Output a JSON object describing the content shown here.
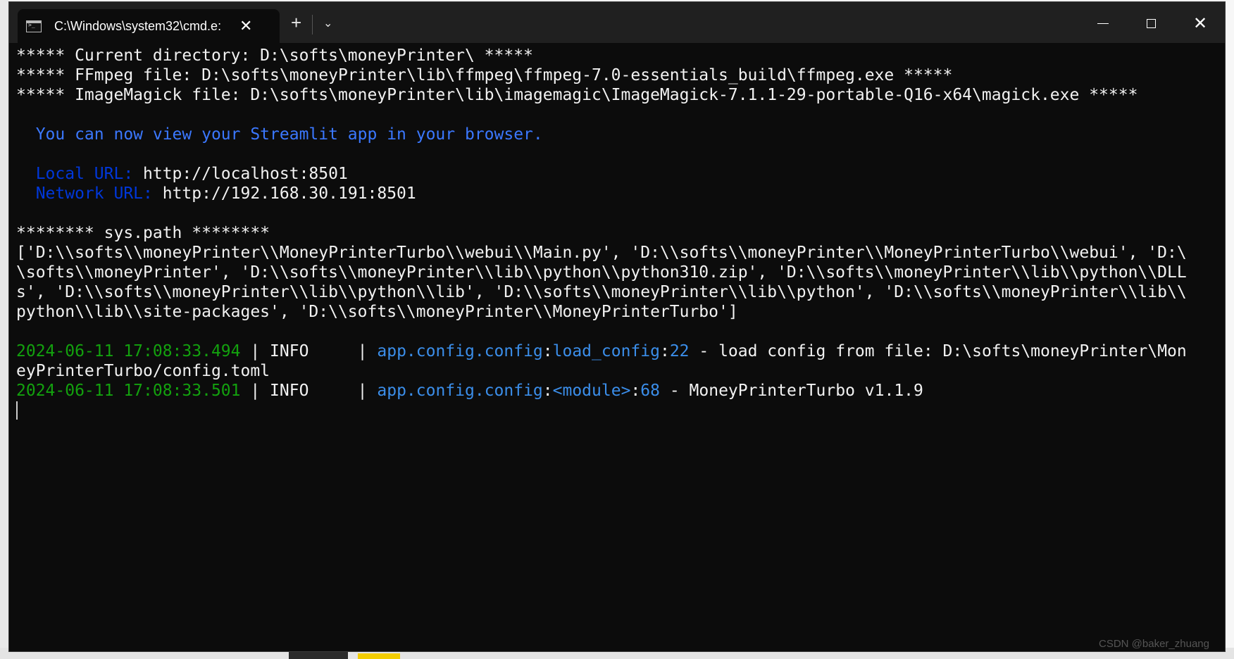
{
  "window": {
    "tab_title": "C:\\Windows\\system32\\cmd.e:",
    "close_tab_glyph": "✕",
    "new_tab_glyph": "+",
    "dropdown_glyph": "⌄",
    "close_window_glyph": "✕"
  },
  "console": {
    "lines": [
      [
        {
          "t": "***** Current directory: D:\\softs\\moneyPrinter\\ *****",
          "c": "white"
        }
      ],
      [
        {
          "t": "***** FFmpeg file: D:\\softs\\moneyPrinter\\lib\\ffmpeg\\ffmpeg-7.0-essentials_build\\ffmpeg.exe *****",
          "c": "white"
        }
      ],
      [
        {
          "t": "***** ImageMagick file: D:\\softs\\moneyPrinter\\lib\\imagemagic\\ImageMagick-7.1.1-29-portable-Q16-x64\\magick.exe *****",
          "c": "white"
        }
      ],
      [],
      [
        {
          "t": "  You can now view your Streamlit app in your browser.",
          "c": "blue"
        }
      ],
      [],
      [
        {
          "t": "  Local URL: ",
          "c": "dblue"
        },
        {
          "t": "http://localhost:8501",
          "c": "white"
        }
      ],
      [
        {
          "t": "  Network URL: ",
          "c": "dblue"
        },
        {
          "t": "http://192.168.30.191:8501",
          "c": "white"
        }
      ],
      [],
      [
        {
          "t": "******** sys.path ********",
          "c": "white"
        }
      ],
      [
        {
          "t": "['D:\\\\softs\\\\moneyPrinter\\\\MoneyPrinterTurbo\\\\webui\\\\Main.py', 'D:\\\\softs\\\\moneyPrinter\\\\MoneyPrinterTurbo\\\\webui', 'D:\\",
          "c": "white"
        }
      ],
      [
        {
          "t": "\\softs\\\\moneyPrinter', 'D:\\\\softs\\\\moneyPrinter\\\\lib\\\\python\\\\python310.zip', 'D:\\\\softs\\\\moneyPrinter\\\\lib\\\\python\\\\DLL",
          "c": "white"
        }
      ],
      [
        {
          "t": "s', 'D:\\\\softs\\\\moneyPrinter\\\\lib\\\\python\\\\lib', 'D:\\\\softs\\\\moneyPrinter\\\\lib\\\\python', 'D:\\\\softs\\\\moneyPrinter\\\\lib\\\\",
          "c": "white"
        }
      ],
      [
        {
          "t": "python\\\\lib\\\\site-packages', 'D:\\\\softs\\\\moneyPrinter\\\\MoneyPrinterTurbo']",
          "c": "white"
        }
      ],
      [],
      [
        {
          "t": "2024-06-11 17:08:33.494",
          "c": "green"
        },
        {
          "t": " | INFO     | ",
          "c": "white"
        },
        {
          "t": "app.config.config",
          "c": "cyan"
        },
        {
          "t": ":",
          "c": "white"
        },
        {
          "t": "load_config",
          "c": "cyan"
        },
        {
          "t": ":",
          "c": "white"
        },
        {
          "t": "22",
          "c": "cyan"
        },
        {
          "t": " - load config from file: D:\\softs\\moneyPrinter\\Mon",
          "c": "white"
        }
      ],
      [
        {
          "t": "eyPrinterTurbo/config.toml",
          "c": "white"
        }
      ],
      [
        {
          "t": "2024-06-11 17:08:33.501",
          "c": "green"
        },
        {
          "t": " | INFO     | ",
          "c": "white"
        },
        {
          "t": "app.config.config",
          "c": "cyan"
        },
        {
          "t": ":",
          "c": "white"
        },
        {
          "t": "<module>",
          "c": "cyan"
        },
        {
          "t": ":",
          "c": "white"
        },
        {
          "t": "68",
          "c": "cyan"
        },
        {
          "t": " - MoneyPrinterTurbo v1.1.9",
          "c": "white"
        }
      ]
    ]
  },
  "watermark": "CSDN @baker_zhuang",
  "colors": {
    "white": "#f2f2f2",
    "blue": "#3b78ff",
    "dblue": "#0037da",
    "green": "#13a10e",
    "cyan": "#3b8eea",
    "background": "#0c0c0c",
    "titlebar": "#202020"
  }
}
